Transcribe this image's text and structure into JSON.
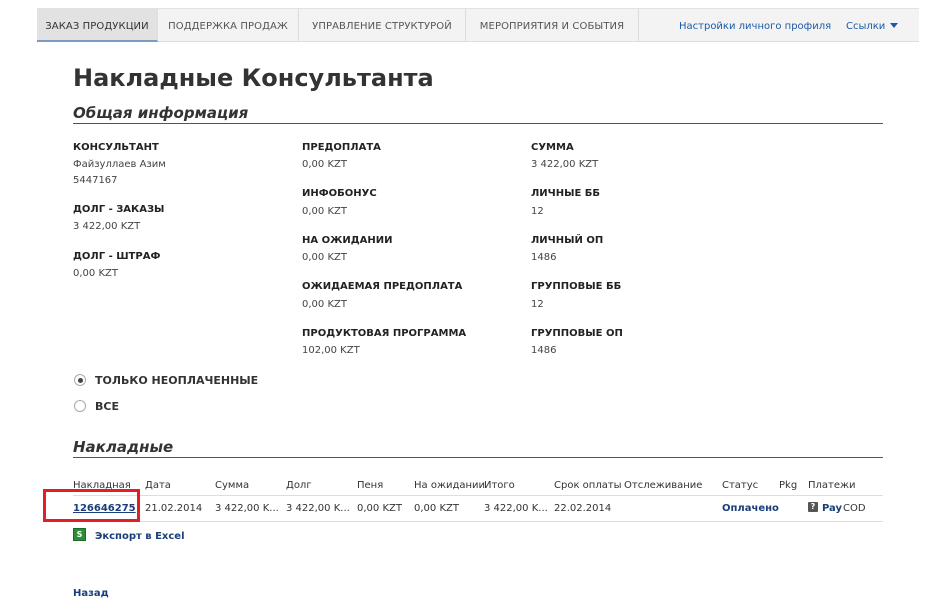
{
  "nav": {
    "tabs": [
      {
        "label": "ЗАКАЗ ПРОДУКЦИИ"
      },
      {
        "label": "ПОДДЕРЖКА ПРОДАЖ"
      },
      {
        "label": "УПРАВЛЕНИЕ СТРУКТУРОЙ"
      },
      {
        "label": "МЕРОПРИЯТИЯ И СОБЫТИЯ"
      }
    ],
    "profile_settings": "Настройки личного профиля",
    "links": "Ссылки"
  },
  "page_title": "Накладные Консультанта",
  "general": {
    "title": "Общая информация",
    "consultant": {
      "label": "КОНСУЛЬТАНТ",
      "name": "Файзуллаев Азим",
      "id": "5447167"
    },
    "debt_orders": {
      "label": "ДОЛГ - ЗАКАЗЫ",
      "value": "3 422,00 KZT"
    },
    "debt_fine": {
      "label": "ДОЛГ - ШТРАФ",
      "value": "0,00 KZT"
    },
    "prepayment": {
      "label": "ПРЕДОПЛАТА",
      "value": "0,00 KZT"
    },
    "infobonus": {
      "label": "ИНФОБОНУС",
      "value": "0,00 KZT"
    },
    "pending": {
      "label": "НА ОЖИДАНИИ",
      "value": "0,00 KZT"
    },
    "expected_prepayment": {
      "label": "ОЖИДАЕМАЯ ПРЕДОПЛАТА",
      "value": "0,00 KZT"
    },
    "product_program": {
      "label": "ПРОДУКТОВАЯ ПРОГРАММА",
      "value": "102,00 KZT"
    },
    "sum": {
      "label": "СУММА",
      "value": "3 422,00 KZT"
    },
    "personal_bb": {
      "label": "ЛИЧНЫЕ ББ",
      "value": "12"
    },
    "personal_op": {
      "label": "ЛИЧНЫЙ ОП",
      "value": "1486"
    },
    "group_bb": {
      "label": "ГРУППОВЫЕ ББ",
      "value": "12"
    },
    "group_op": {
      "label": "ГРУППОВЫЕ ОП",
      "value": "1486"
    }
  },
  "filter": {
    "unpaid_only": "ТОЛЬКО НЕОПЛАЧЕННЫЕ",
    "all": "ВСЕ",
    "selected": "unpaid_only"
  },
  "invoices": {
    "title": "Накладные",
    "columns": {
      "invoice": "Накладная",
      "date": "Дата",
      "sum": "Сумма",
      "debt": "Долг",
      "fine": "Пеня",
      "pending": "На ожидании",
      "total": "Итого",
      "due_date": "Срок оплаты",
      "tracking": "Отслеживание",
      "status": "Статус",
      "pkg": "Pkg",
      "payments": "Платежи"
    },
    "row": {
      "invoice": "126646275",
      "date": "21.02.2014",
      "sum": "3 422,00 K...",
      "debt": "3 422,00 K...",
      "fine": "0,00 KZT",
      "pending": "0,00 KZT",
      "total": "3 422,00 K...",
      "due_date": "22.02.2014",
      "tracking": "",
      "status": "Оплачено",
      "pkg": "",
      "pay_link": "Pay",
      "payment_method": "COD"
    },
    "export_excel": "Экспорт в Excel"
  },
  "back": "Назад",
  "colors": {
    "accent_link": "#1a3e7a",
    "highlight_box": "#e21f26",
    "excel_green": "#2e8b3a"
  }
}
